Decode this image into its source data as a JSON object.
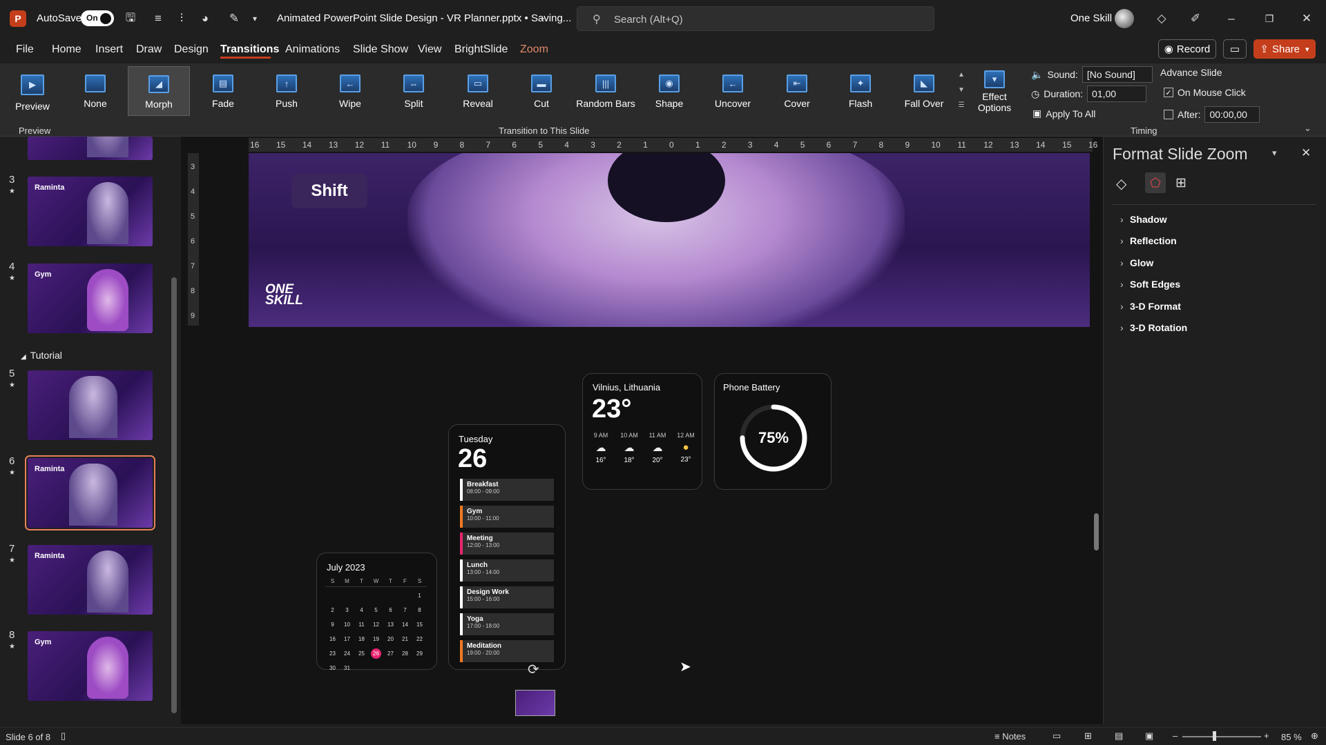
{
  "titlebar": {
    "logo": "P",
    "autosave_label": "AutoSave",
    "autosave_state": "On",
    "doc_title": "Animated PowerPoint Slide Design - VR Planner.pptx • Saving...",
    "search_placeholder": "Search (Alt+Q)",
    "user_name": "One Skill"
  },
  "menu": {
    "items": [
      "File",
      "Home",
      "Insert",
      "Draw",
      "Design",
      "Transitions",
      "Animations",
      "Slide Show",
      "View",
      "BrightSlide",
      "Zoom"
    ],
    "active": "Transitions",
    "record_label": "Record",
    "share_label": "Share"
  },
  "ribbon": {
    "preview_label": "Preview",
    "preview_group": "Preview",
    "transitions": [
      "None",
      "Morph",
      "Fade",
      "Push",
      "Wipe",
      "Split",
      "Reveal",
      "Cut",
      "Random Bars",
      "Shape",
      "Uncover",
      "Cover",
      "Flash",
      "Fall Over"
    ],
    "selected_transition": "Morph",
    "effect_options": [
      "Effect",
      "Options"
    ],
    "transition_group": "Transition to This Slide",
    "sound_label": "Sound:",
    "sound_value": "[No Sound]",
    "duration_label": "Duration:",
    "duration_value": "01,00",
    "apply_all": "Apply To All",
    "advance_label": "Advance Slide",
    "on_click_label": "On Mouse Click",
    "after_label": "After:",
    "after_value": "00:00,00",
    "timing_group": "Timing"
  },
  "thumbnails": {
    "section": "Tutorial",
    "slides": [
      {
        "num": "3",
        "text": "Raminta"
      },
      {
        "num": "4",
        "text": "Gym"
      },
      {
        "num": "5",
        "text": ""
      },
      {
        "num": "6",
        "text": "Raminta"
      },
      {
        "num": "7",
        "text": "Raminta"
      },
      {
        "num": "8",
        "text": "Gym"
      }
    ],
    "selected": "6"
  },
  "ruler": {
    "top": [
      "16",
      "15",
      "14",
      "13",
      "12",
      "11",
      "10",
      "9",
      "8",
      "7",
      "6",
      "5",
      "4",
      "3",
      "2",
      "1",
      "0",
      "1",
      "2",
      "3",
      "4",
      "5",
      "6",
      "7",
      "8",
      "9",
      "10",
      "11",
      "12",
      "13",
      "14",
      "15",
      "16"
    ],
    "left": [
      "3",
      "4",
      "5",
      "6",
      "7",
      "8",
      "9"
    ]
  },
  "slide": {
    "shift": "Shift",
    "logo_line1": "ONE",
    "logo_line2": "SKILL"
  },
  "weather": {
    "city": "Vilnius, Lithuania",
    "temp": "23°",
    "hours": [
      "9 AM",
      "10 AM",
      "11 AM",
      "12 AM"
    ],
    "temps": [
      "16°",
      "18°",
      "20°",
      "23°"
    ]
  },
  "battery": {
    "title": "Phone Battery",
    "label": "75%",
    "level": 0.75
  },
  "schedule": {
    "day": "Tuesday",
    "date": "26",
    "items": [
      {
        "name": "Breakfast",
        "time": "08:00 - 09:00",
        "color": "#ffffff"
      },
      {
        "name": "Gym",
        "time": "10:00 - 11:00",
        "color": "#f07a22"
      },
      {
        "name": "Meeting",
        "time": "12:00 - 13:00",
        "color": "#e8246f"
      },
      {
        "name": "Lunch",
        "time": "13:00 - 14:00",
        "color": "#ffffff"
      },
      {
        "name": "Design Work",
        "time": "15:00 - 16:00",
        "color": "#ffffff"
      },
      {
        "name": "Yoga",
        "time": "17:00 - 18:00",
        "color": "#ffffff"
      },
      {
        "name": "Meditation",
        "time": "19:00 - 20:00",
        "color": "#f07a22"
      }
    ]
  },
  "calendar": {
    "month": "July 2023",
    "weekdays": [
      "S",
      "M",
      "T",
      "W",
      "T",
      "F",
      "S"
    ],
    "weeks": [
      [
        "",
        "",
        "",
        "",
        "",
        "",
        "1"
      ],
      [
        "2",
        "3",
        "4",
        "5",
        "6",
        "7",
        "8"
      ],
      [
        "9",
        "10",
        "11",
        "12",
        "13",
        "14",
        "15"
      ],
      [
        "16",
        "17",
        "18",
        "19",
        "20",
        "21",
        "22"
      ],
      [
        "23",
        "24",
        "25",
        "26",
        "27",
        "28",
        "29"
      ],
      [
        "30",
        "31",
        "",
        "",
        "",
        "",
        ""
      ]
    ],
    "highlight": "26",
    "accent": "#e8246f"
  },
  "format_pane": {
    "title": "Format Slide Zoom",
    "sections": [
      "Shadow",
      "Reflection",
      "Glow",
      "Soft Edges",
      "3-D Format",
      "3-D Rotation"
    ]
  },
  "statusbar": {
    "slide_info": "Slide 6 of 8",
    "notes": "Notes",
    "zoom": "85 %"
  },
  "colors": {
    "brand": "#c43e1c",
    "accent": "#e8246f"
  }
}
